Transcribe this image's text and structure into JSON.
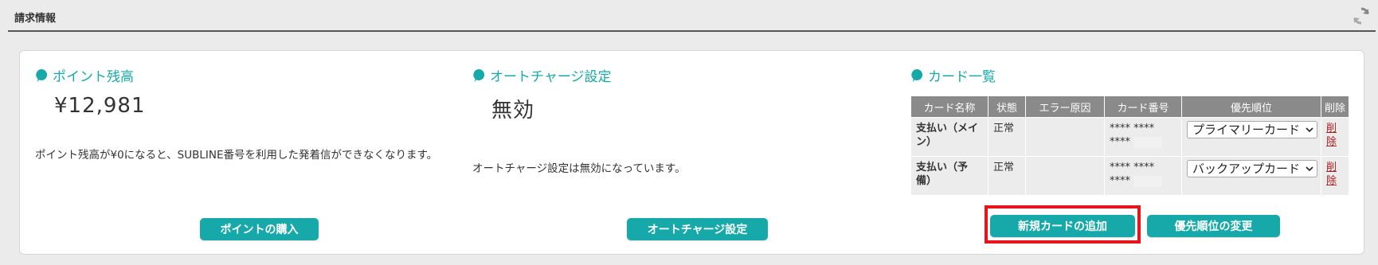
{
  "header": {
    "title": "請求情報",
    "refresh_icon": "refresh-icon"
  },
  "points": {
    "title": "ポイント残高",
    "balance": "¥12,981",
    "note": "ポイント残高が¥0になると、SUBLINE番号を利用した発着信ができなくなります。",
    "button": "ポイントの購入"
  },
  "autocharge": {
    "title": "オートチャージ設定",
    "status": "無効",
    "note": "オートチャージ設定は無効になっています。",
    "button": "オートチャージ設定"
  },
  "cards": {
    "title": "カード一覧",
    "columns": [
      "カード名称",
      "状態",
      "エラー原因",
      "カード番号",
      "優先順位",
      "削除"
    ],
    "rows": [
      {
        "name_line1": "支払い（メイ",
        "name_line2": "ン）",
        "status": "正常",
        "error": "",
        "number_line1": "**** ****",
        "number_line2": "****",
        "priority": "プライマリーカード",
        "delete": "削除"
      },
      {
        "name_line1": "支払い（予",
        "name_line2": "備）",
        "status": "正常",
        "error": "",
        "number_line1": "**** ****",
        "number_line2": "****",
        "priority": "バックアップカード",
        "delete": "削除"
      }
    ],
    "add_button": "新規カードの追加",
    "priority_button": "優先順位の変更"
  },
  "colors": {
    "accent": "#17a9a9",
    "highlight": "#e8141b",
    "table_header": "#8a8a8a",
    "delete_link": "#b01c1c"
  }
}
